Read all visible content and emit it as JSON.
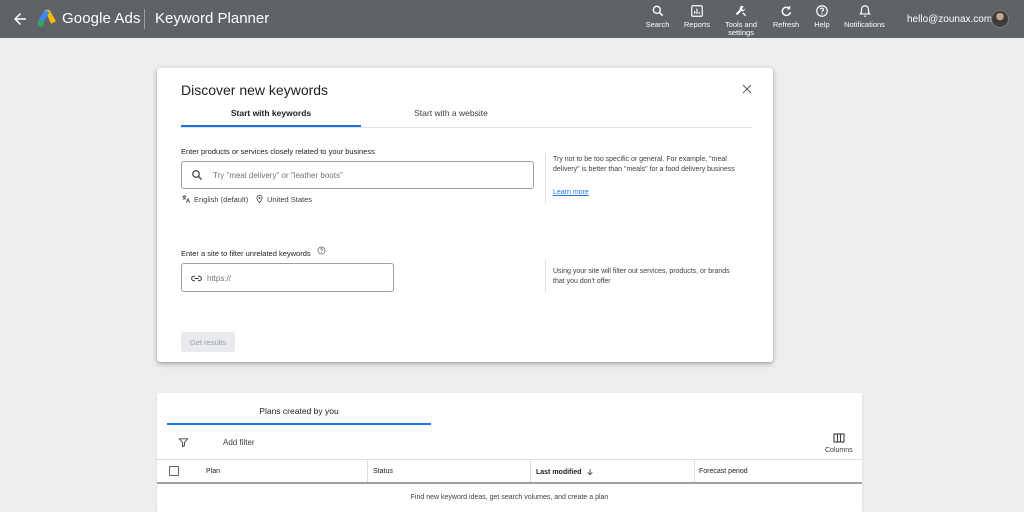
{
  "header": {
    "brand": "Google Ads",
    "product": "Keyword Planner",
    "tools": [
      {
        "label": "Search",
        "icon": "search-icon"
      },
      {
        "label": "Reports",
        "icon": "reports-icon"
      },
      {
        "label": "Tools and settings",
        "icon": "wrench-icon"
      },
      {
        "label": "Refresh",
        "icon": "refresh-icon"
      },
      {
        "label": "Help",
        "icon": "help-icon"
      },
      {
        "label": "Notifications",
        "icon": "bell-icon"
      }
    ],
    "account": "hello@zounax.com"
  },
  "dialog": {
    "title": "Discover new keywords",
    "tabs": [
      {
        "label": "Start with keywords",
        "active": true
      },
      {
        "label": "Start with a website",
        "active": false
      }
    ],
    "keywords_label": "Enter products or services closely related to your business",
    "keywords_placeholder": "Try \"meal delivery\" or \"leather boots\"",
    "language": "English (default)",
    "location": "United States",
    "keywords_hint": "Try not to be too specific or general. For example, \"meal delivery\" is better than \"meals\" for a food delivery business",
    "learn_more": "Learn more",
    "site_label": "Enter a site to filter unrelated keywords",
    "site_placeholder": "https://",
    "site_hint": "Using your site will filter out services, products, or brands that you don't offer",
    "submit_label": "Get results"
  },
  "plans": {
    "tab": "Plans created by you",
    "add_filter": "Add filter",
    "columns_label": "Columns",
    "table_headers": [
      "Plan",
      "Status",
      "Last modified",
      "Forecast period"
    ],
    "empty_message": "Find new keyword ideas, get search volumes, and create a plan"
  },
  "colors": {
    "topbar": "#5f6368",
    "accent": "#1a73e8",
    "background": "#eeeeee"
  }
}
